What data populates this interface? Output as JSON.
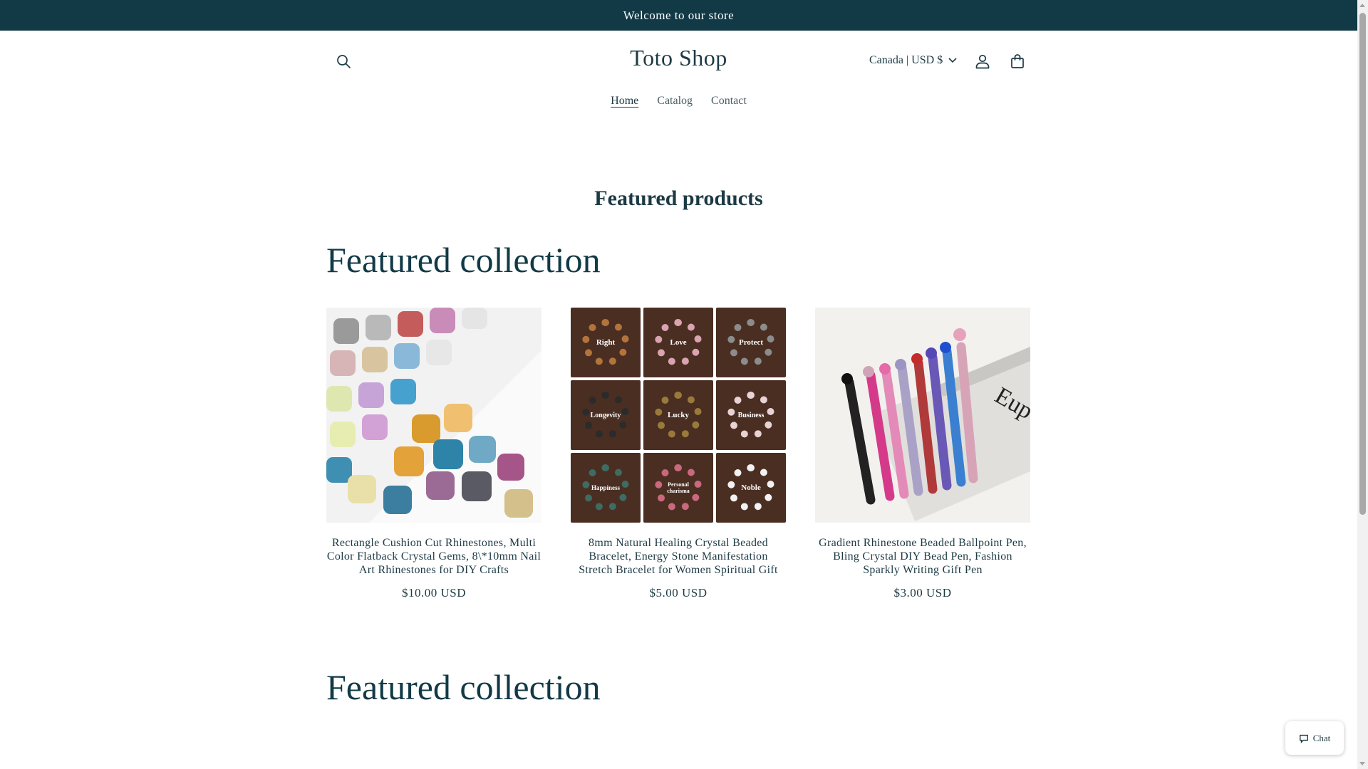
{
  "announcement": {
    "text": "Welcome to our store"
  },
  "header": {
    "logo": "Toto Shop",
    "country_selector": "Canada | USD $",
    "icons": {
      "search": "search-icon",
      "account": "user-icon",
      "cart": "cart-icon"
    }
  },
  "nav": {
    "items": [
      {
        "label": "Home",
        "active": true
      },
      {
        "label": "Catalog",
        "active": false
      },
      {
        "label": "Contact",
        "active": false
      }
    ]
  },
  "main": {
    "section_title": "Featured products",
    "collections": [
      {
        "title": "Featured collection",
        "products": [
          {
            "title": "Rectangle Cushion Cut Rhinestones, Multi Color Flatback Crystal Gems, 8\\*10mm Nail Art Rhinestones for DIY Crafts",
            "price": "$10.00 USD",
            "image": "crystal-rhinestones"
          },
          {
            "title": "8mm Natural Healing Crystal Beaded Bracelet, Energy Stone Manifestation Stretch Bracelet for Women Spiritual Gift",
            "price": "$5.00 USD",
            "image": "beaded-bracelets",
            "image_labels": [
              "Right",
              "Love",
              "Protect",
              "Longevity",
              "Lucky",
              "Business",
              "Happiness",
              "Personal charisma",
              "Noble"
            ]
          },
          {
            "title": "Gradient Rhinestone Beaded Ballpoint Pen, Bling Crystal DIY Bead Pen, Fashion Sparkly Writing Gift Pen",
            "price": "$3.00 USD",
            "image": "rhinestone-pens",
            "image_text": "Eup"
          }
        ]
      },
      {
        "title": "Featured collection",
        "products": []
      }
    ]
  },
  "chat": {
    "label": "Chat"
  },
  "colors": {
    "announcement_bg": "#123a46",
    "text": "#1d3a44"
  }
}
